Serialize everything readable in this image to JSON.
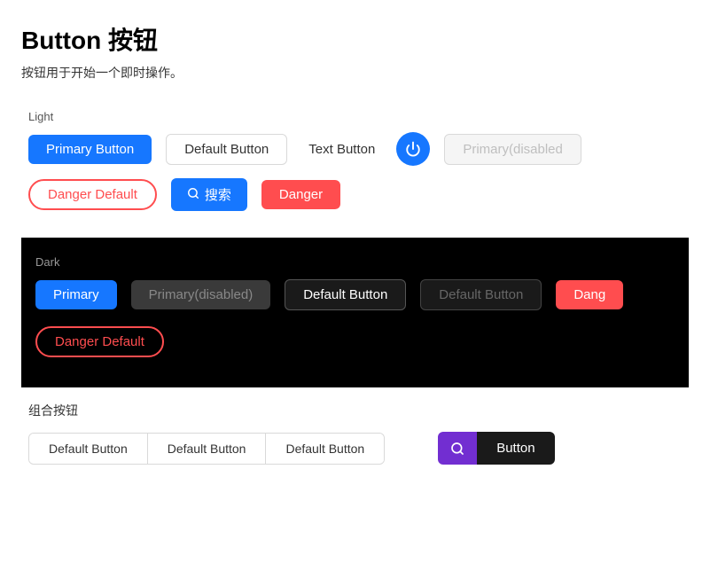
{
  "page": {
    "title": "Button 按钮",
    "subtitle": "按钮用于开始一个即时操作。"
  },
  "light": {
    "label": "Light",
    "row1": {
      "primary": "Primary Button",
      "default": "Default Button",
      "text": "Text Button",
      "primary_disabled": "Primary(disabled"
    },
    "row2": {
      "danger_default": "Danger Default",
      "search_icon": "🔍",
      "search_label": "搜索",
      "danger": "Danger"
    }
  },
  "dark": {
    "label": "Dark",
    "row1": {
      "primary": "Primary",
      "primary_disabled": "Primary(disabled)",
      "default1": "Default Button",
      "default2": "Default Button",
      "danger": "Dang"
    },
    "row2": {
      "danger_default": "Danger Default"
    }
  },
  "combo": {
    "label": "组合按钮",
    "group": [
      "Default Button",
      "Default Button",
      "Default Button"
    ],
    "search_icon": "🔍",
    "button_label": "Button"
  }
}
